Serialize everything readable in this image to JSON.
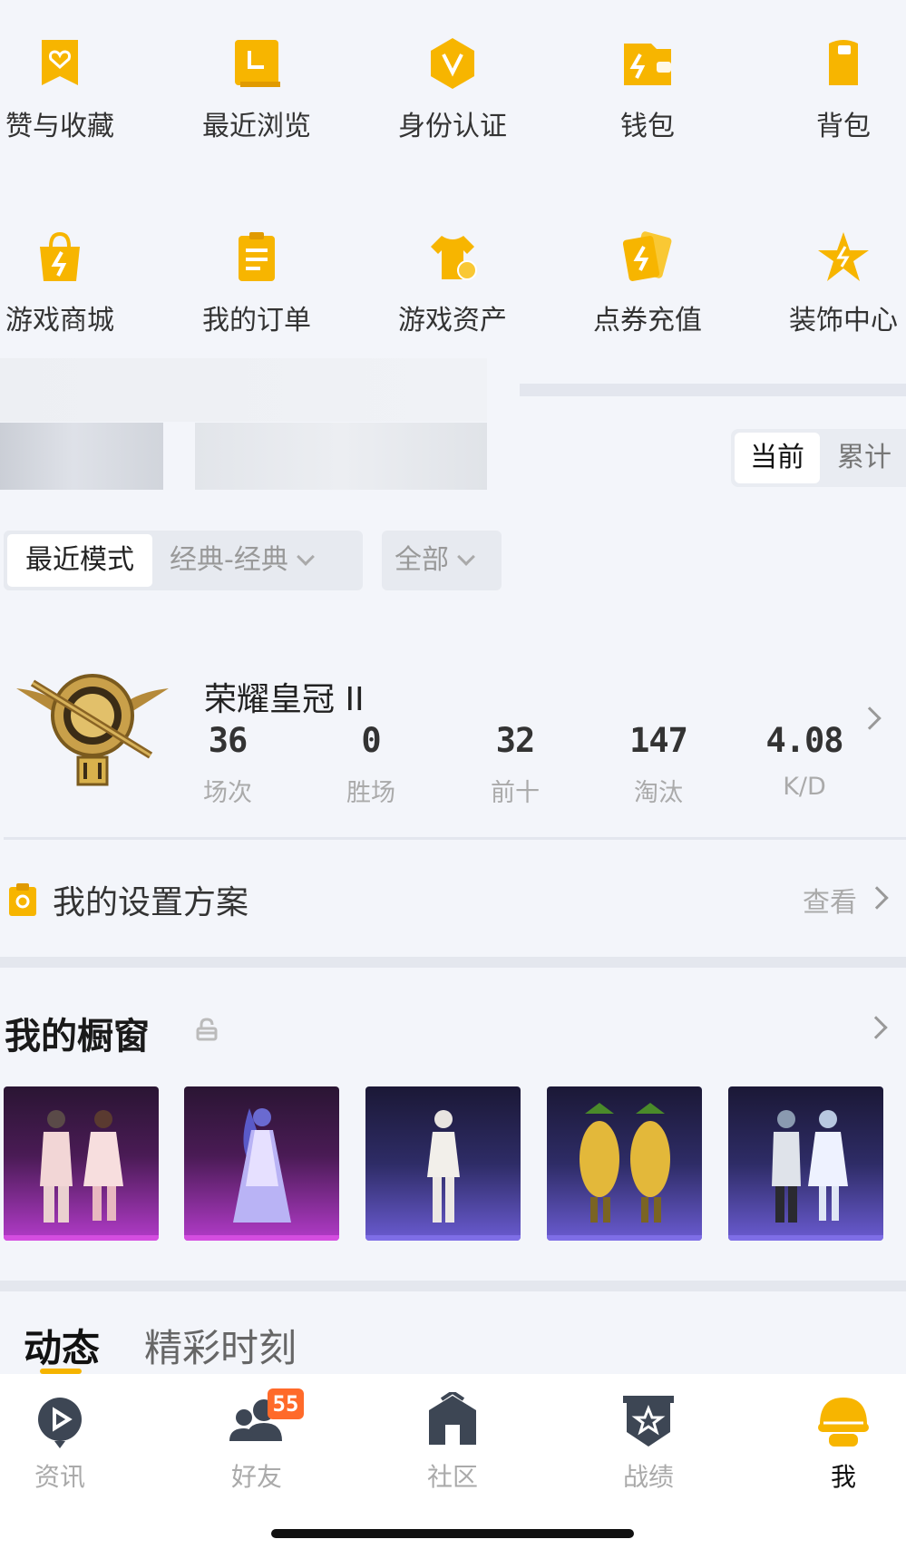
{
  "quick_grid": {
    "row1": [
      {
        "label": "赞与收藏",
        "icon": "likes-favorites-icon"
      },
      {
        "label": "最近浏览",
        "icon": "recent-browse-icon"
      },
      {
        "label": "身份认证",
        "icon": "identity-verify-icon"
      },
      {
        "label": "钱包",
        "icon": "wallet-icon"
      },
      {
        "label": "背包",
        "icon": "backpack-icon"
      }
    ],
    "row2": [
      {
        "label": "游戏商城",
        "icon": "game-mall-icon"
      },
      {
        "label": "我的订单",
        "icon": "my-orders-icon"
      },
      {
        "label": "游戏资产",
        "icon": "game-assets-icon"
      },
      {
        "label": "点券充值",
        "icon": "coupon-recharge-icon"
      },
      {
        "label": "装饰中心",
        "icon": "decoration-center-icon"
      }
    ]
  },
  "stats_toggle": {
    "current": "当前",
    "cumulative": "累计"
  },
  "filters": {
    "mode": "最近模式",
    "classic": "经典-经典",
    "all": "全部"
  },
  "rank": {
    "name": "荣耀皇冠 II",
    "stats": [
      {
        "value": "36",
        "label": "场次"
      },
      {
        "value": "0",
        "label": "胜场"
      },
      {
        "value": "32",
        "label": "前十"
      },
      {
        "value": "147",
        "label": "淘汰"
      },
      {
        "value": "4.08",
        "label": "K/D"
      }
    ]
  },
  "settings": {
    "label": "我的设置方案",
    "view": "查看"
  },
  "showcase": {
    "title": "我的橱窗"
  },
  "feed_tabs": {
    "dynamic": "动态",
    "highlights": "精彩时刻"
  },
  "bottom_nav": {
    "items": [
      {
        "label": "资讯",
        "icon": "news-icon"
      },
      {
        "label": "好友",
        "icon": "friends-icon",
        "badge": "55"
      },
      {
        "label": "社区",
        "icon": "community-icon"
      },
      {
        "label": "战绩",
        "icon": "record-icon"
      },
      {
        "label": "我",
        "icon": "me-icon"
      }
    ]
  },
  "colors": {
    "accent": "#f5b400",
    "badge": "#ff6a2a",
    "background": "#f3f5fa"
  }
}
